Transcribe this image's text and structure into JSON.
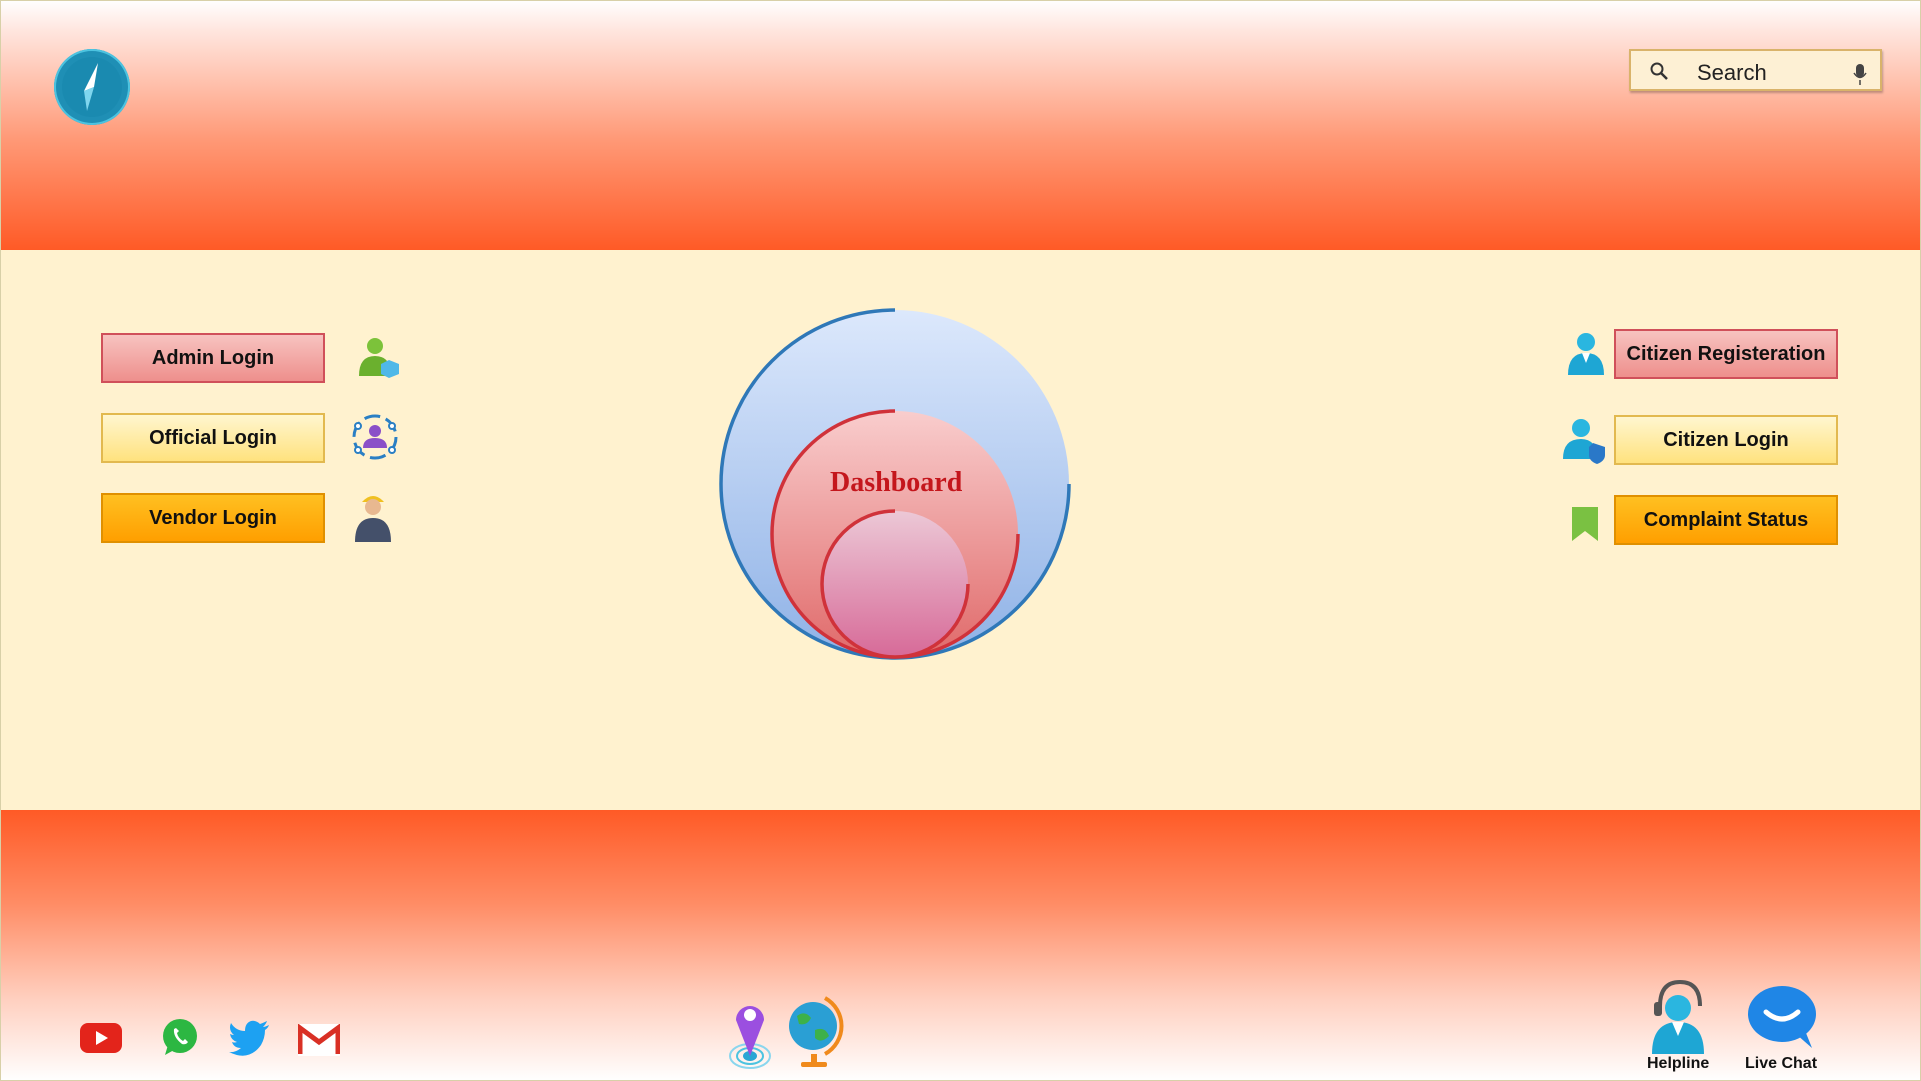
{
  "header": {
    "logo_icon": "compass-icon",
    "search": {
      "placeholder": "Search",
      "icon": "search-icon",
      "mic_icon": "microphone-icon"
    }
  },
  "left_buttons": [
    {
      "label": "Admin Login",
      "icon": "admin-user-icon"
    },
    {
      "label": "Official Login",
      "icon": "official-user-icon"
    },
    {
      "label": "Vendor Login",
      "icon": "vendor-worker-icon"
    }
  ],
  "right_buttons": [
    {
      "label": "Citizen Registeration",
      "icon": "citizen-user-icon"
    },
    {
      "label": "Citizen Login",
      "icon": "citizen-shield-icon"
    },
    {
      "label": "Complaint Status",
      "icon": "bookmark-icon"
    }
  ],
  "dashboard": {
    "label": "Dashboard"
  },
  "footer": {
    "social": [
      "youtube-icon",
      "whatsapp-icon",
      "twitter-icon",
      "gmail-icon"
    ],
    "center": [
      "location-pin-icon",
      "globe-icon"
    ],
    "support": [
      {
        "label": "Helpline",
        "icon": "helpline-agent-icon"
      },
      {
        "label": "Live Chat",
        "icon": "chat-bubble-icon"
      }
    ]
  },
  "colors": {
    "header_orange": "#ff5a26",
    "main_bg": "#fff2cf",
    "dashboard_text": "#c4161c"
  }
}
